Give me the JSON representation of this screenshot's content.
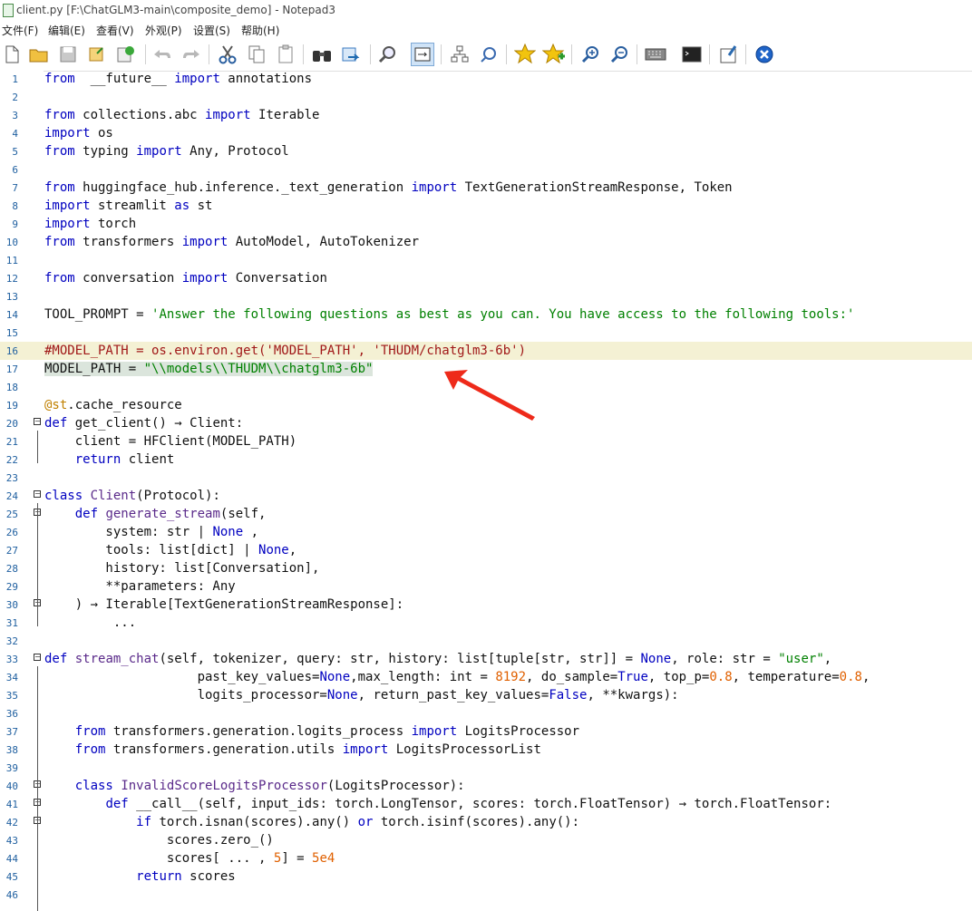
{
  "window": {
    "title": "client.py [F:\\ChatGLM3-main\\composite_demo] - Notepad3"
  },
  "menu": [
    "文件(F)",
    "编辑(E)",
    "查看(V)",
    "外观(P)",
    "设置(S)",
    "帮助(H)"
  ],
  "toolbar": {
    "icons": [
      "new-file-icon",
      "open-folder-icon",
      "save-icon",
      "browse-icon",
      "save-as-icon",
      "undo-icon",
      "redo-icon",
      "cut-icon",
      "copy-icon",
      "paste-icon",
      "find-icon",
      "replace-icon",
      "zoom-find-icon",
      "word-wrap-icon",
      "schema-icon",
      "scheme-config-icon",
      "favorite-icon",
      "add-favorite-icon",
      "zoom-in-icon",
      "zoom-out-icon",
      "keyboard-icon",
      "terminal-icon",
      "pin-icon",
      "exit-icon"
    ]
  },
  "colors": {
    "highlight_line": "#f4f1d4",
    "selection": "#dbe5dc",
    "keyword": "#0000c0",
    "string": "#008000",
    "number": "#e06000",
    "comment": "#a01818",
    "arrow": "#ee2a1a"
  },
  "lines": [
    {
      "n": "1",
      "t": [
        [
          "kw",
          "from"
        ],
        [
          "",
          "  __future__ "
        ],
        [
          "kw",
          "import"
        ],
        [
          "",
          " annotations"
        ]
      ]
    },
    {
      "n": "2",
      "t": []
    },
    {
      "n": "3",
      "t": [
        [
          "kw",
          "from"
        ],
        [
          "",
          " collections.abc "
        ],
        [
          "kw",
          "import"
        ],
        [
          "",
          " Iterable"
        ]
      ]
    },
    {
      "n": "4",
      "t": [
        [
          "kw",
          "import"
        ],
        [
          "",
          " os"
        ]
      ]
    },
    {
      "n": "5",
      "t": [
        [
          "kw",
          "from"
        ],
        [
          "",
          " typing "
        ],
        [
          "kw",
          "import"
        ],
        [
          "",
          " Any, Protocol"
        ]
      ]
    },
    {
      "n": "6",
      "t": []
    },
    {
      "n": "7",
      "t": [
        [
          "kw",
          "from"
        ],
        [
          "",
          " huggingface_hub.inference._text_generation "
        ],
        [
          "kw",
          "import"
        ],
        [
          "",
          " TextGenerationStreamResponse, Token"
        ]
      ]
    },
    {
      "n": "8",
      "t": [
        [
          "kw",
          "import"
        ],
        [
          "",
          " streamlit "
        ],
        [
          "kw",
          "as"
        ],
        [
          "",
          " st"
        ]
      ]
    },
    {
      "n": "9",
      "t": [
        [
          "kw",
          "import"
        ],
        [
          "",
          " torch"
        ]
      ]
    },
    {
      "n": "10",
      "t": [
        [
          "kw",
          "from"
        ],
        [
          "",
          " transformers "
        ],
        [
          "kw",
          "import"
        ],
        [
          "",
          " AutoModel, AutoTokenizer"
        ]
      ]
    },
    {
      "n": "11",
      "t": []
    },
    {
      "n": "12",
      "t": [
        [
          "kw",
          "from"
        ],
        [
          "",
          " conversation "
        ],
        [
          "kw",
          "import"
        ],
        [
          "",
          " Conversation"
        ]
      ]
    },
    {
      "n": "13",
      "t": []
    },
    {
      "n": "14",
      "t": [
        [
          "",
          "TOOL_PROMPT = "
        ],
        [
          "str",
          "'Answer the following questions as best as you can. You have access to the following tools:'"
        ]
      ]
    },
    {
      "n": "15",
      "t": []
    },
    {
      "n": "16",
      "t": [
        [
          "cmt",
          "#MODEL_PATH = os.environ.get('MODEL_PATH', 'THUDM/chatglm3-6b')"
        ]
      ],
      "hl": true
    },
    {
      "n": "17",
      "t": [
        [
          "sel",
          "MODEL_PATH = "
        ],
        [
          "selstr",
          "\"\\\\models\\\\THUDM\\\\chatglm3-6b\""
        ]
      ]
    },
    {
      "n": "18",
      "t": []
    },
    {
      "n": "19",
      "t": [
        [
          "dec",
          "@st"
        ],
        [
          "",
          ".cache_resource"
        ]
      ]
    },
    {
      "n": "20",
      "t": [
        [
          "kw",
          "def"
        ],
        [
          "",
          " get_client() → Client:"
        ]
      ],
      "fold": true
    },
    {
      "n": "21",
      "t": [
        [
          "",
          "    client = HFClient(MODEL_PATH)"
        ]
      ]
    },
    {
      "n": "22",
      "t": [
        [
          "",
          "    "
        ],
        [
          "kw",
          "return"
        ],
        [
          "",
          " client"
        ]
      ]
    },
    {
      "n": "23",
      "t": []
    },
    {
      "n": "24",
      "t": [
        [
          "kw",
          "class"
        ],
        [
          "",
          " "
        ],
        [
          "fn",
          "Client"
        ],
        [
          "",
          "(Protocol):"
        ]
      ],
      "fold": true
    },
    {
      "n": "25",
      "t": [
        [
          "",
          "    "
        ],
        [
          "kw",
          "def"
        ],
        [
          "",
          " "
        ],
        [
          "fn",
          "generate_stream"
        ],
        [
          "",
          "(self,"
        ]
      ],
      "fold": true
    },
    {
      "n": "26",
      "t": [
        [
          "",
          "        system: str | "
        ],
        [
          "kw",
          "None"
        ],
        [
          "",
          " ,"
        ]
      ]
    },
    {
      "n": "27",
      "t": [
        [
          "",
          "        tools: list[dict] | "
        ],
        [
          "kw",
          "None"
        ],
        [
          "",
          ","
        ]
      ]
    },
    {
      "n": "28",
      "t": [
        [
          "",
          "        history: list[Conversation],"
        ]
      ]
    },
    {
      "n": "29",
      "t": [
        [
          "",
          "        **parameters: Any"
        ]
      ]
    },
    {
      "n": "30",
      "t": [
        [
          "",
          "    ) → Iterable[TextGenerationStreamResponse]:"
        ]
      ],
      "fold": true
    },
    {
      "n": "31",
      "t": [
        [
          "",
          "         ..."
        ]
      ]
    },
    {
      "n": "32",
      "t": []
    },
    {
      "n": "33",
      "t": [
        [
          "kw",
          "def"
        ],
        [
          "",
          " "
        ],
        [
          "fn",
          "stream_chat"
        ],
        [
          "",
          "(self, tokenizer, query: str, history: list[tuple[str, str]] = "
        ],
        [
          "kw",
          "None"
        ],
        [
          "",
          ", role: str = "
        ],
        [
          "str",
          "\"user\""
        ],
        [
          "",
          ","
        ]
      ],
      "fold": true
    },
    {
      "n": "34",
      "t": [
        [
          "",
          "                    past_key_values="
        ],
        [
          "kw",
          "None"
        ],
        [
          "",
          ",max_length: int = "
        ],
        [
          "num",
          "8192"
        ],
        [
          "",
          ", do_sample="
        ],
        [
          "kw",
          "True"
        ],
        [
          "",
          ", top_p="
        ],
        [
          "num",
          "0.8"
        ],
        [
          "",
          ", temperature="
        ],
        [
          "num",
          "0.8"
        ],
        [
          "",
          ","
        ]
      ]
    },
    {
      "n": "35",
      "t": [
        [
          "",
          "                    logits_processor="
        ],
        [
          "kw",
          "None"
        ],
        [
          "",
          ", return_past_key_values="
        ],
        [
          "kw",
          "False"
        ],
        [
          "",
          ", **kwargs):"
        ]
      ]
    },
    {
      "n": "36",
      "t": []
    },
    {
      "n": "37",
      "t": [
        [
          "",
          "    "
        ],
        [
          "kw",
          "from"
        ],
        [
          "",
          " transformers.generation.logits_process "
        ],
        [
          "kw",
          "import"
        ],
        [
          "",
          " LogitsProcessor"
        ]
      ]
    },
    {
      "n": "38",
      "t": [
        [
          "",
          "    "
        ],
        [
          "kw",
          "from"
        ],
        [
          "",
          " transformers.generation.utils "
        ],
        [
          "kw",
          "import"
        ],
        [
          "",
          " LogitsProcessorList"
        ]
      ]
    },
    {
      "n": "39",
      "t": []
    },
    {
      "n": "40",
      "t": [
        [
          "",
          "    "
        ],
        [
          "kw",
          "class"
        ],
        [
          "",
          " "
        ],
        [
          "fn",
          "InvalidScoreLogitsProcessor"
        ],
        [
          "",
          "(LogitsProcessor):"
        ]
      ],
      "fold": true
    },
    {
      "n": "41",
      "t": [
        [
          "",
          "        "
        ],
        [
          "kw",
          "def"
        ],
        [
          "",
          " __call__(self, input_ids: torch.LongTensor, scores: torch.FloatTensor) → torch.FloatTensor:"
        ]
      ],
      "fold": true
    },
    {
      "n": "42",
      "t": [
        [
          "",
          "            "
        ],
        [
          "kw",
          "if"
        ],
        [
          "",
          " torch.isnan(scores).any() "
        ],
        [
          "kw",
          "or"
        ],
        [
          "",
          " torch.isinf(scores).any():"
        ]
      ],
      "fold": true
    },
    {
      "n": "43",
      "t": [
        [
          "",
          "                scores.zero_()"
        ]
      ]
    },
    {
      "n": "44",
      "t": [
        [
          "",
          "                scores[ ... , "
        ],
        [
          "num",
          "5"
        ],
        [
          "",
          "] = "
        ],
        [
          "num",
          "5e4"
        ]
      ]
    },
    {
      "n": "45",
      "t": [
        [
          "",
          "            "
        ],
        [
          "kw",
          "return"
        ],
        [
          "",
          " scores"
        ]
      ]
    },
    {
      "n": "46",
      "t": []
    }
  ]
}
